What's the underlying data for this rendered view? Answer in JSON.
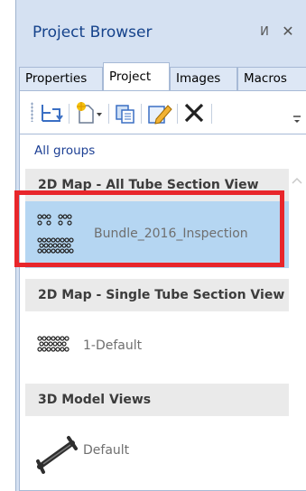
{
  "panel": {
    "title": "Project Browser",
    "pin_glyph": "И",
    "close_glyph": "✕"
  },
  "tabs": [
    {
      "label": "Properties",
      "active": false
    },
    {
      "label": "Project",
      "active": true
    },
    {
      "label": "Images",
      "active": false
    },
    {
      "label": "Macros",
      "active": false
    }
  ],
  "toolbar": {
    "icons": [
      "collapse-icon",
      "new-item-icon",
      "copy-icon",
      "edit-icon",
      "delete-icon",
      "overflow-icon"
    ]
  },
  "list": {
    "all_groups_label": "All groups",
    "groups": [
      {
        "header": "2D Map - All Tube Section View",
        "items": [
          {
            "label": "Bundle_2016_Inspection",
            "selected": true,
            "thumb": "tube-map-thumb"
          }
        ]
      },
      {
        "header": "2D Map - Single Tube Section View",
        "items": [
          {
            "label": "1-Default",
            "selected": false,
            "thumb": "tube-map-thumb"
          }
        ]
      },
      {
        "header": "3D Model Views",
        "items": [
          {
            "label": "Default",
            "selected": false,
            "thumb": "3d-model-thumb"
          }
        ]
      }
    ]
  },
  "colors": {
    "accent": "#15428b",
    "selection": "#b5d6f2",
    "highlight_border": "#e8262b"
  }
}
